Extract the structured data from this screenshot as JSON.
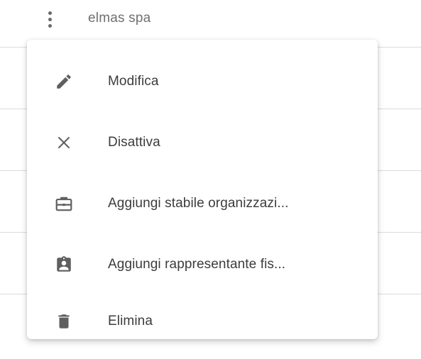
{
  "row": {
    "company_name": "elmas spa"
  },
  "menu": {
    "items": [
      {
        "label": "Modifica",
        "icon": "pencil-icon"
      },
      {
        "label": "Disattiva",
        "icon": "close-icon"
      },
      {
        "label": "Aggiungi stabile organizzazi...",
        "icon": "briefcase-icon"
      },
      {
        "label": "Aggiungi rappresentante fis...",
        "icon": "clipboard-account-icon"
      },
      {
        "label": "Elimina",
        "icon": "trash-icon"
      }
    ]
  },
  "colors": {
    "icon": "#5f5f5f",
    "text": "#3c3c3c",
    "divider": "#dcdcdc"
  }
}
